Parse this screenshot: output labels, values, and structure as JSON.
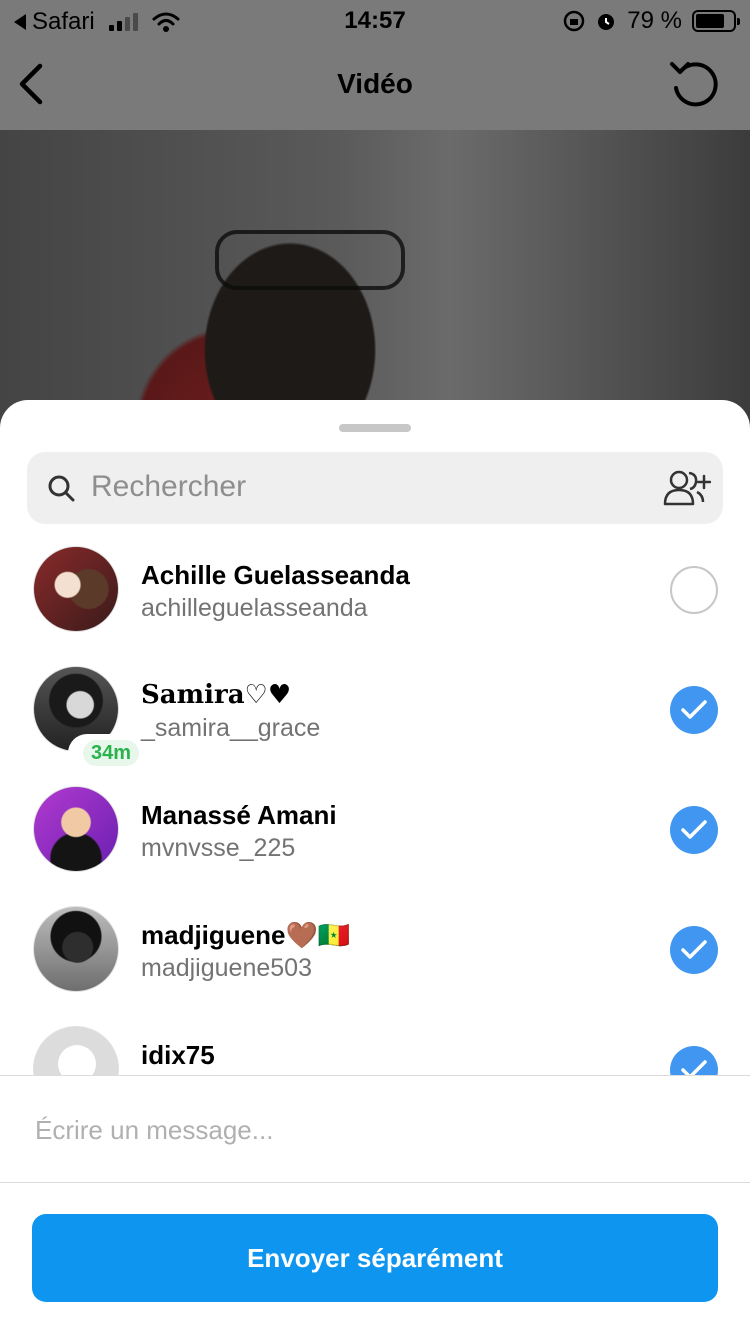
{
  "status_bar": {
    "back_app": "Safari",
    "time": "14:57",
    "battery": "79 %"
  },
  "nav": {
    "title": "Vidéo"
  },
  "search": {
    "placeholder": "Rechercher"
  },
  "contacts": [
    {
      "name": "Achille Guelasseanda",
      "handle": "achilleguelasseanda",
      "selected": false
    },
    {
      "name": "Samira♡♥",
      "handle": "_samira__grace",
      "selected": true,
      "badge": "34m"
    },
    {
      "name": "Manassé Amani",
      "handle": "mvnvsse_225",
      "selected": true
    },
    {
      "name": "madjiguene🤎🇸🇳",
      "handle": "madjiguene503",
      "selected": true
    },
    {
      "name": "idix75",
      "handle": "",
      "selected": true
    }
  ],
  "message": {
    "placeholder": "Écrire un message..."
  },
  "send_button": {
    "label": "Envoyer séparément"
  },
  "colors": {
    "accent": "#0d95f0",
    "check": "#4096f0",
    "online": "#2bb24c"
  }
}
